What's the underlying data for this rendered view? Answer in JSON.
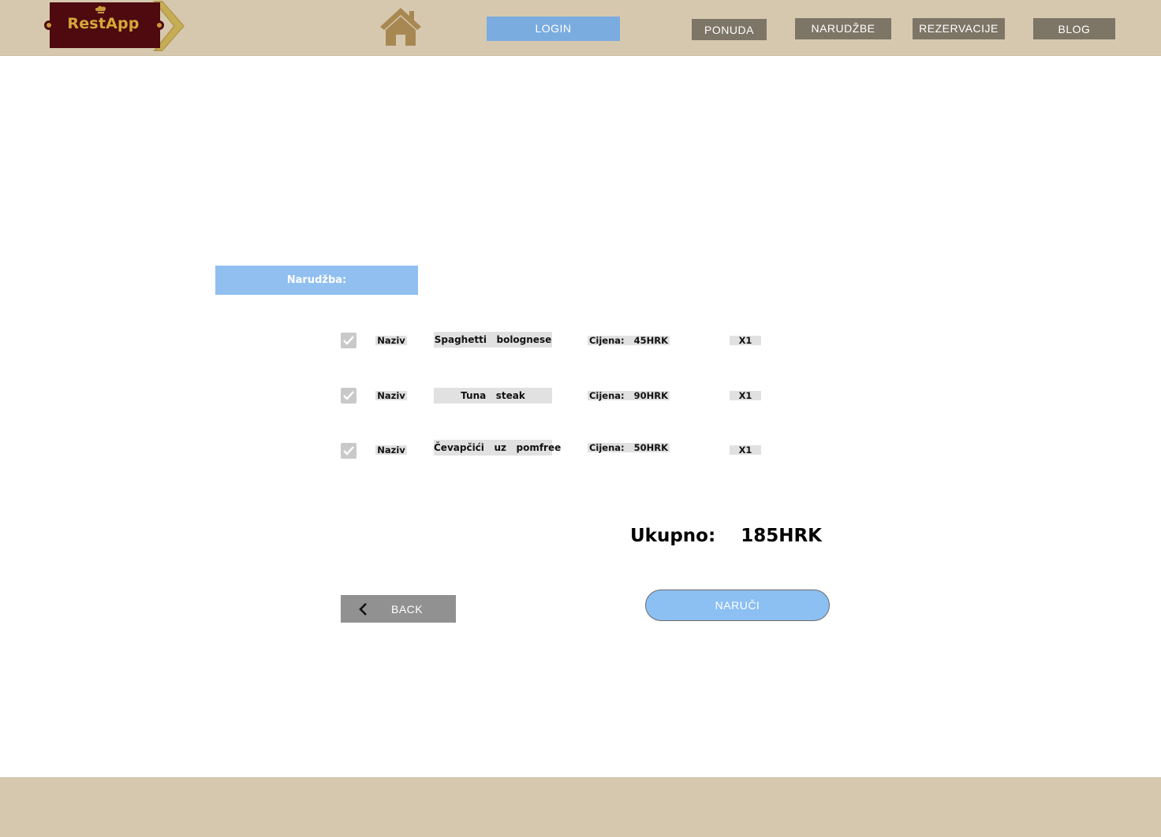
{
  "header": {
    "logo_text": "RestApp",
    "nav": {
      "login": "LOGIN",
      "ponuda": "PONUDA",
      "narudzbe": "NARUDŽBE",
      "rezervacije": "REZERVACIJE",
      "blog": "BLOG"
    }
  },
  "order": {
    "heading": "Narudžba:",
    "items": [
      {
        "checked": true,
        "field_label": "Naziv",
        "name": "Spaghetti   bolognese",
        "price": "Cijena:   45HRK",
        "qty": "X1"
      },
      {
        "checked": true,
        "field_label": "Naziv",
        "name": "Tuna   steak",
        "price": "Cijena:   90HRK",
        "qty": "X1"
      },
      {
        "checked": true,
        "field_label": "Naziv",
        "name": "Čevapčići   uz   pomfree",
        "price": "Cijena:   50HRK",
        "qty": "X1"
      }
    ],
    "total": "Ukupno:    185HRK"
  },
  "actions": {
    "back": "BACK",
    "order": "NARUČI"
  },
  "colors": {
    "header_bg": "#d6c8ae",
    "nav_button": "#7d7566",
    "login_button": "#7aace0",
    "order_button": "#8cbff2",
    "back_button": "#919191"
  }
}
